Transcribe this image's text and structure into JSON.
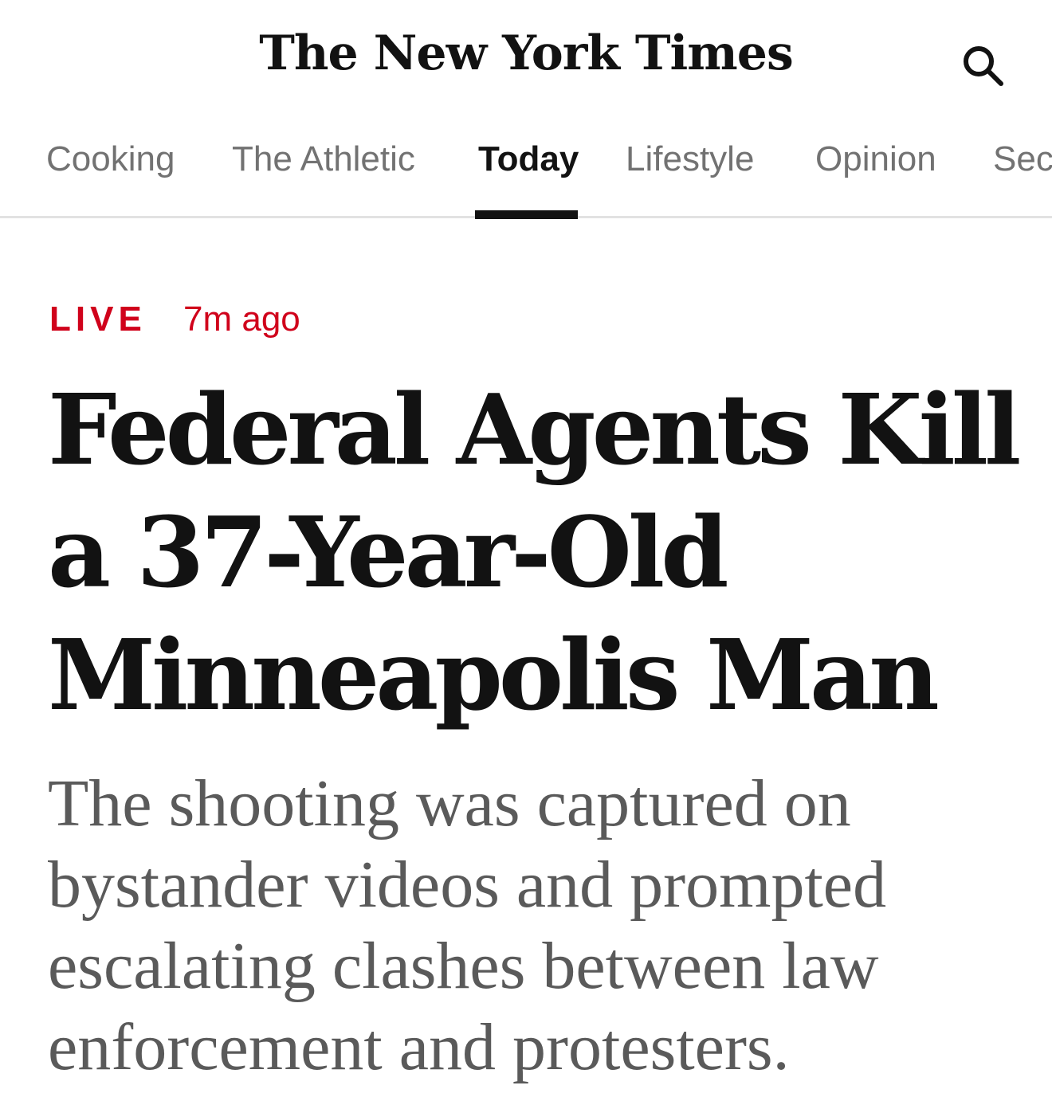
{
  "masthead": {
    "logo_text": "The New York Times",
    "search_icon": "search-icon"
  },
  "nav": {
    "items": [
      {
        "label": "Cooking",
        "active": false
      },
      {
        "label": "The Athletic",
        "active": false
      },
      {
        "label": "Today",
        "active": true
      },
      {
        "label": "Lifestyle",
        "active": false
      },
      {
        "label": "Opinion",
        "active": false
      },
      {
        "label": "Sec",
        "active": false
      }
    ]
  },
  "story": {
    "live_label": "LIVE",
    "timestamp": "7m ago",
    "headline": "Federal Agents Kill a 37-Year-Old Minneapolis Man",
    "summary": "The shooting was captured on bystander videos and prompted escalating clashes between law enforcement and protesters."
  },
  "colors": {
    "live_red": "#d0021b",
    "text_dark": "#121212",
    "nav_gray": "#727272",
    "summary_gray": "#5a5a5a",
    "divider": "#e2e2e2"
  }
}
